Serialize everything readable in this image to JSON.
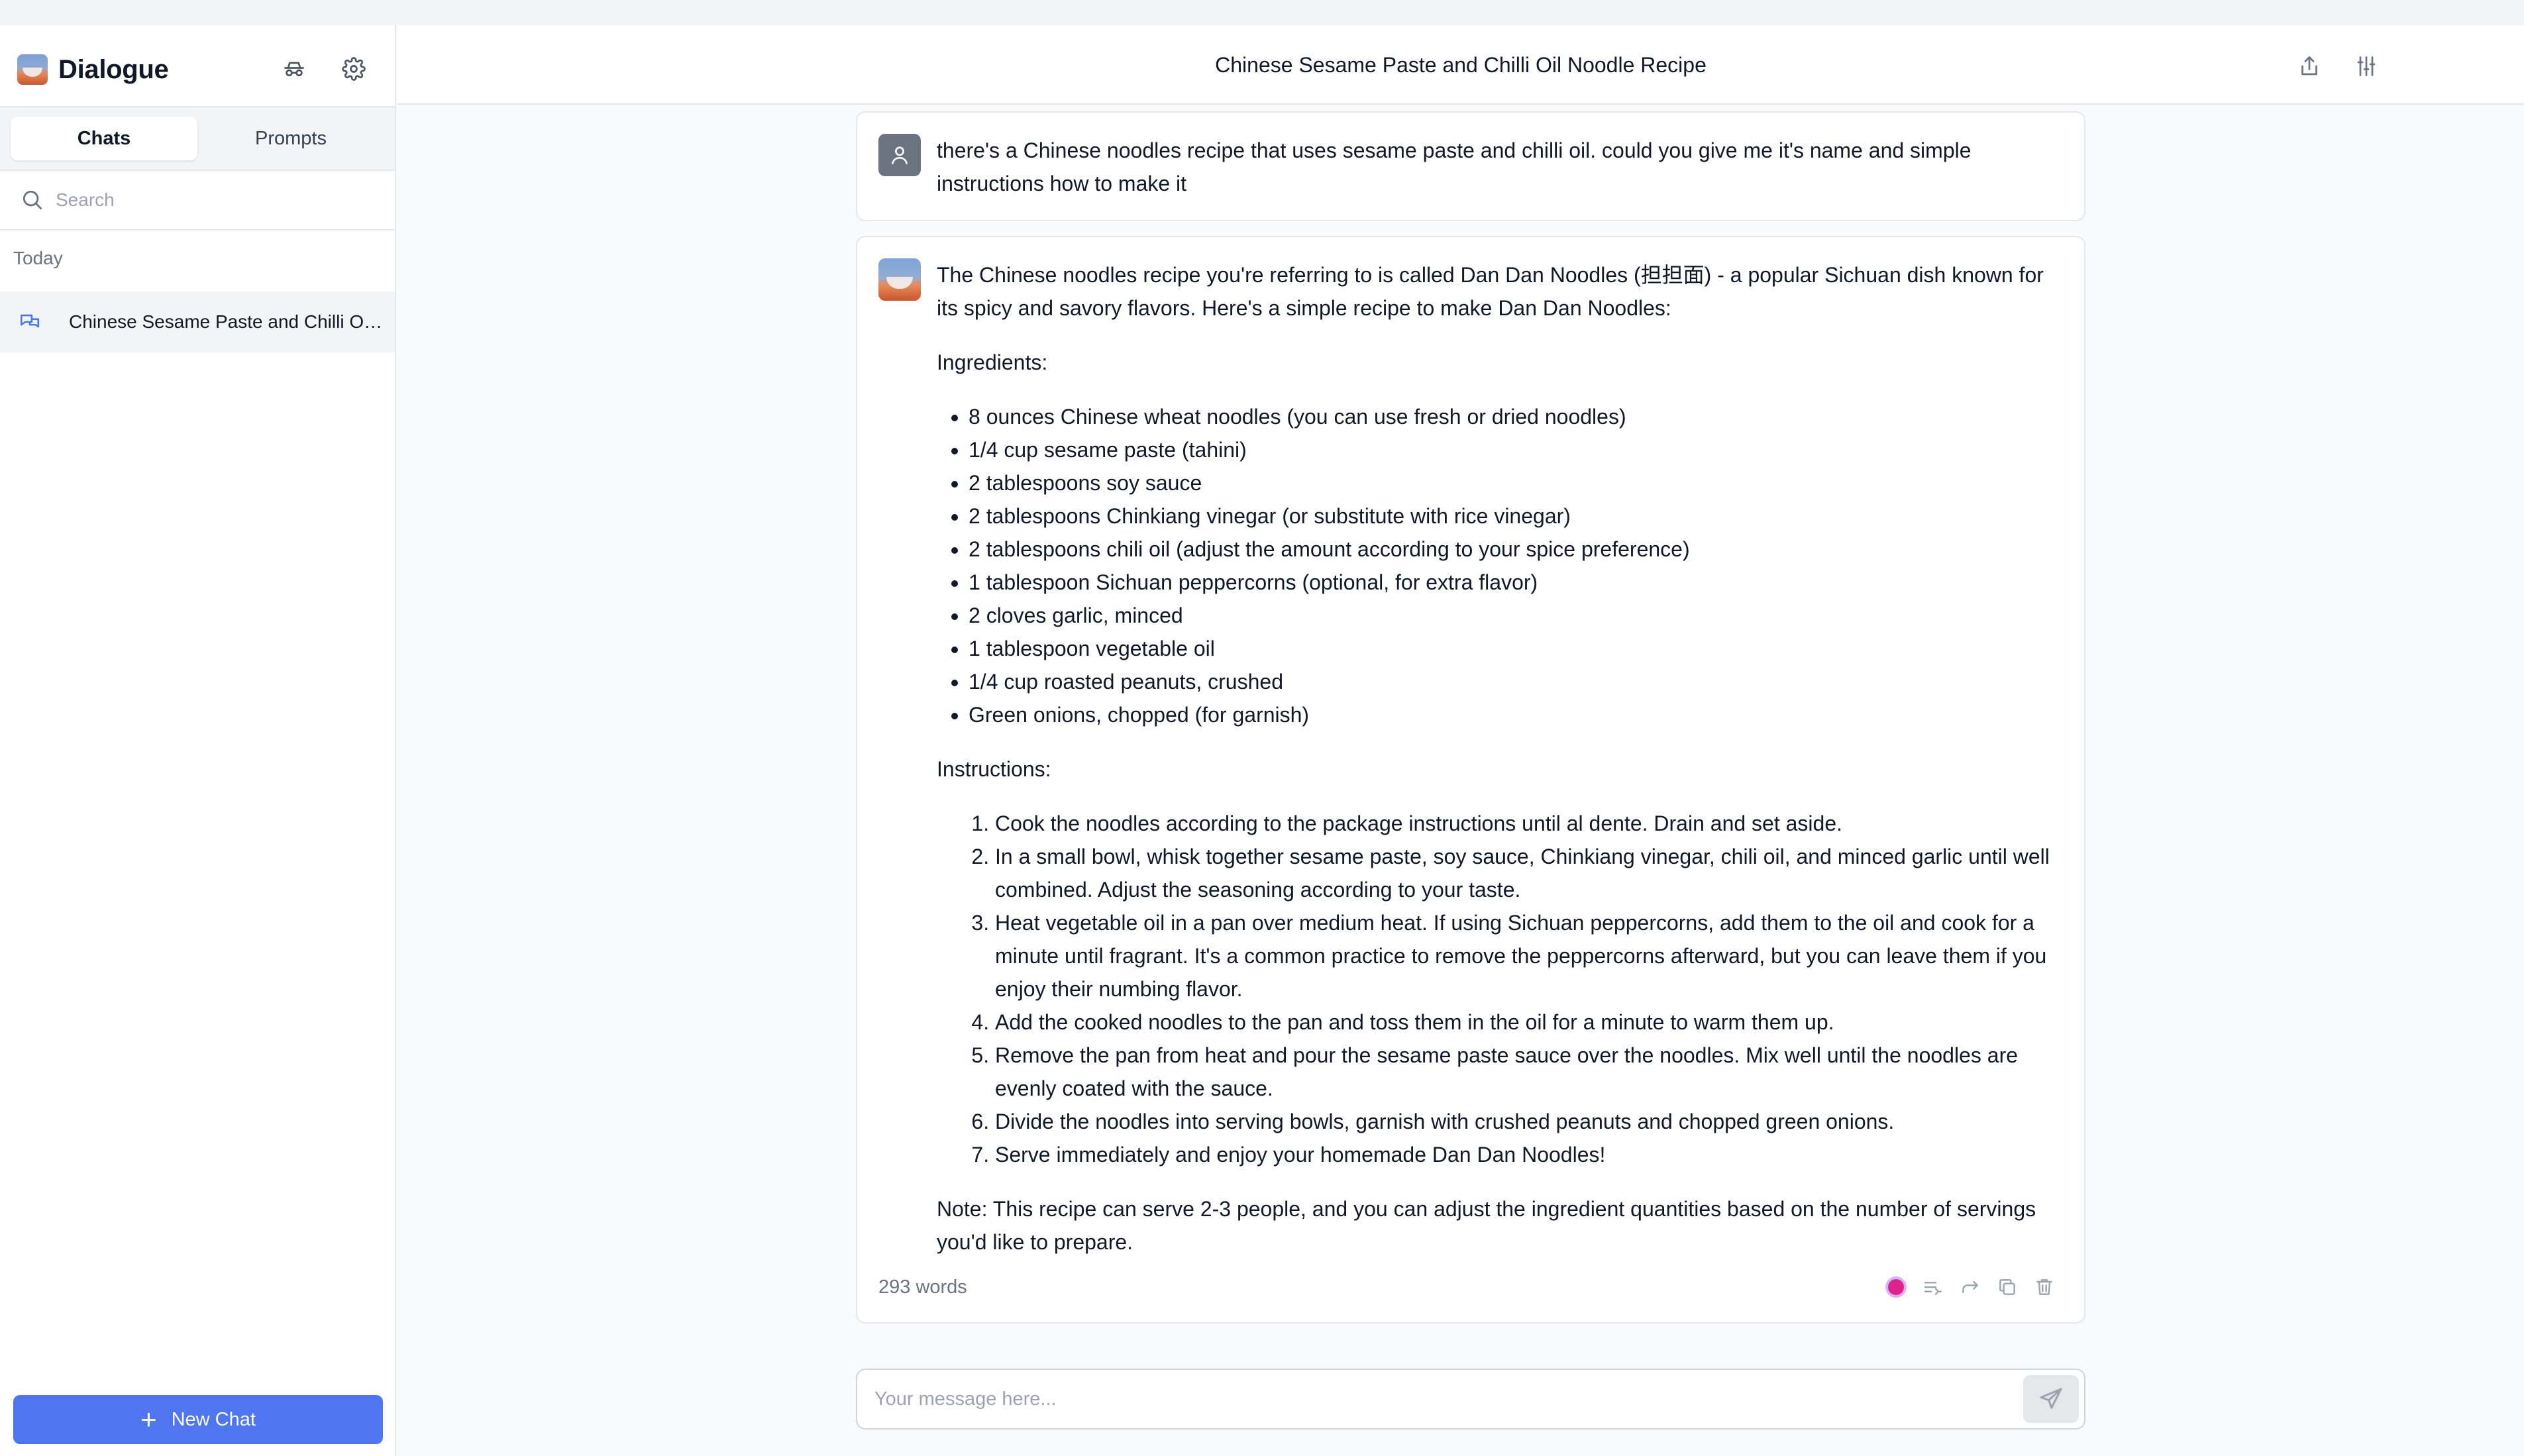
{
  "app": {
    "name": "Dialogue"
  },
  "sidebar": {
    "tabs": [
      {
        "label": "Chats",
        "active": true
      },
      {
        "label": "Prompts",
        "active": false
      }
    ],
    "search": {
      "placeholder": "Search"
    },
    "section_label": "Today",
    "chats": [
      {
        "title": "Chinese Sesame Paste and Chilli Oil Noodle Recipe",
        "selected": true
      }
    ],
    "new_chat_label": "New Chat",
    "icons": [
      "incognito-icon",
      "gear-icon",
      "search-icon",
      "chat-bubbles-icon",
      "plus-icon"
    ]
  },
  "header": {
    "title": "Chinese Sesame Paste and Chilli Oil Noodle Recipe",
    "icons": [
      "share-icon",
      "sliders-icon"
    ]
  },
  "messages": {
    "user": {
      "text": "there's a Chinese noodles recipe that uses sesame paste and chilli oil. could you give me it's name and simple instructions how to make it"
    },
    "assistant": {
      "intro": "The Chinese noodles recipe you're referring to is called Dan Dan Noodles (担担面) - a popular Sichuan dish known for its spicy and savory flavors. Here's a simple recipe to make Dan Dan Noodles:",
      "ingredients_heading": "Ingredients:",
      "ingredients": [
        "8 ounces Chinese wheat noodles (you can use fresh or dried noodles)",
        "1/4 cup sesame paste (tahini)",
        "2 tablespoons soy sauce",
        "2 tablespoons Chinkiang vinegar (or substitute with rice vinegar)",
        "2 tablespoons chili oil (adjust the amount according to your spice preference)",
        "1 tablespoon Sichuan peppercorns (optional, for extra flavor)",
        "2 cloves garlic, minced",
        "1 tablespoon vegetable oil",
        "1/4 cup roasted peanuts, crushed",
        "Green onions, chopped (for garnish)"
      ],
      "instructions_heading": "Instructions:",
      "instructions": [
        "Cook the noodles according to the package instructions until al dente. Drain and set aside.",
        "In a small bowl, whisk together sesame paste, soy sauce, Chinkiang vinegar, chili oil, and minced garlic until well combined. Adjust the seasoning according to your taste.",
        "Heat vegetable oil in a pan over medium heat. If using Sichuan peppercorns, add them to the oil and cook for a minute until fragrant. It's a common practice to remove the peppercorns afterward, but you can leave them if you enjoy their numbing flavor.",
        "Add the cooked noodles to the pan and toss them in the oil for a minute to warm them up.",
        "Remove the pan from heat and pour the sesame paste sauce over the noodles. Mix well until the noodles are evenly coated with the sauce.",
        "Divide the noodles into serving bowls, garnish with crushed peanuts and chopped green onions.",
        "Serve immediately and enjoy your homemade Dan Dan Noodles!"
      ],
      "note": "Note: This recipe can serve 2-3 people, and you can adjust the ingredient quantities based on the number of servings you'd like to prepare.",
      "word_count": "293 words",
      "action_icons": [
        "speak-icon",
        "continue-icon",
        "fork-icon",
        "copy-icon",
        "trash-icon"
      ]
    }
  },
  "composer": {
    "placeholder": "Your message here...",
    "send_icon": "send-icon"
  },
  "colors": {
    "accent": "#4f75f0",
    "selected_bg": "#f3f4f6",
    "speak_dot": "#e0218a"
  }
}
